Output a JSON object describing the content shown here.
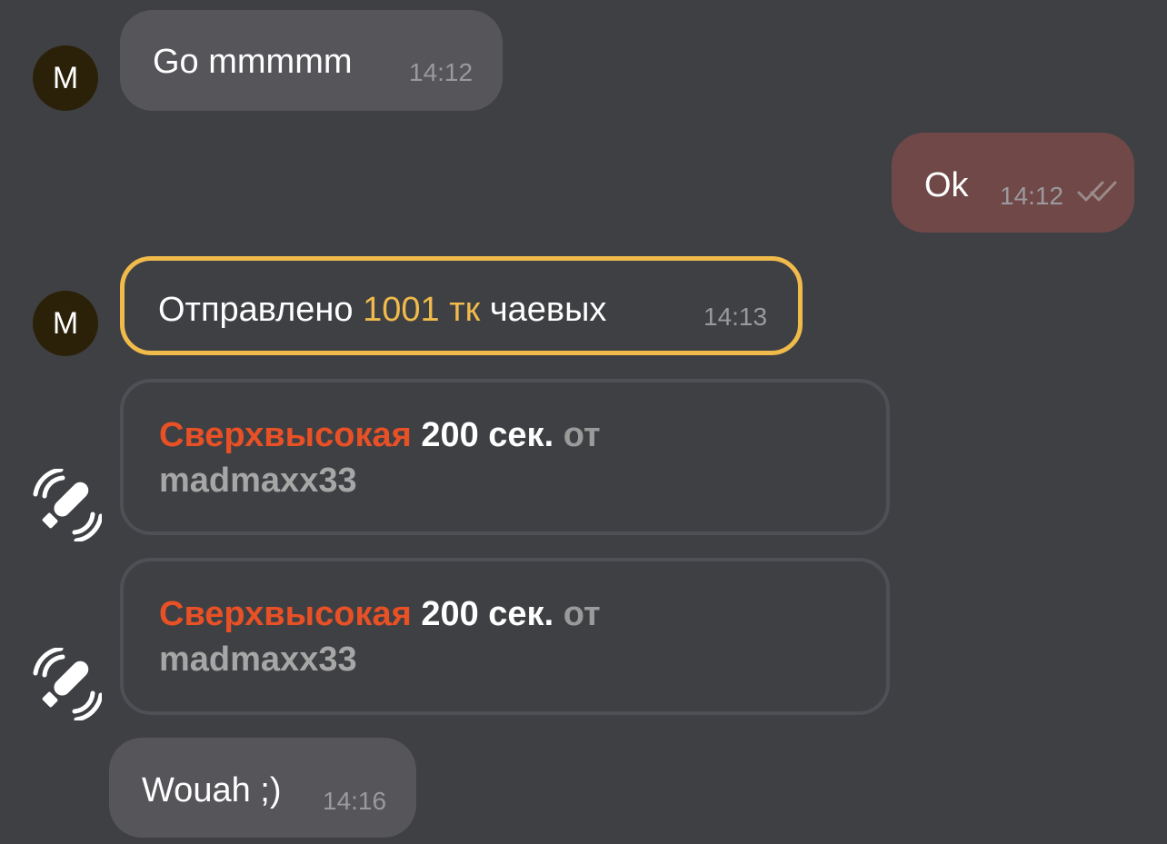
{
  "colors": {
    "background": "#3f4044",
    "incoming_bubble": "#55555a",
    "outgoing_bubble": "#714848",
    "tip_accent": "#f0bb4b",
    "level_accent": "#e85025",
    "avatar_bg": "#2b2108"
  },
  "messages": [
    {
      "avatar": "M",
      "text": "Go mmmmm",
      "time": "14:12"
    },
    {
      "text": "Ok",
      "time": "14:12",
      "status_icon": "double-check-icon"
    },
    {
      "avatar": "M",
      "prefix": "Отправлено",
      "amount": "1001 тк",
      "suffix": "чаевых",
      "time": "14:13"
    },
    {
      "icon": "vibrator-icon",
      "level": "Сверхвысокая",
      "duration": "200 сек.",
      "from": "от",
      "user": "madmaxx33"
    },
    {
      "icon": "vibrator-icon",
      "level": "Сверхвысокая",
      "duration": "200 сек.",
      "from": "от",
      "user": "madmaxx33"
    },
    {
      "text": "Wouah ;)",
      "time": "14:16"
    }
  ]
}
